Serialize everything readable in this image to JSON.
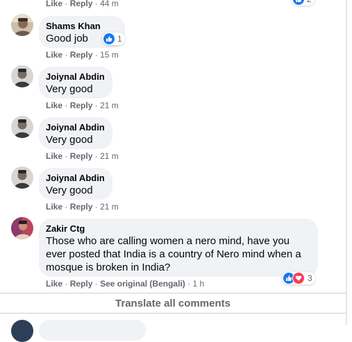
{
  "prev_actions": {
    "like": "Like",
    "reply": "Reply",
    "time": "44 m",
    "reaction_count": "2"
  },
  "comments": [
    {
      "author": "Shams Khan",
      "text": "Good job",
      "like": "Like",
      "reply": "Reply",
      "time": "15 m",
      "reaction_count": "1"
    },
    {
      "author": "Joiynal Abdin",
      "text": "Very good",
      "like": "Like",
      "reply": "Reply",
      "time": "21 m"
    },
    {
      "author": "Joiynal Abdin",
      "text": "Very good",
      "like": "Like",
      "reply": "Reply",
      "time": "21 m"
    },
    {
      "author": "Joiynal Abdin",
      "text": "Very good",
      "like": "Like",
      "reply": "Reply",
      "time": "21 m"
    },
    {
      "author": "Zakir Ctg",
      "text": "Those who are calling women a nero mind, have you ever posted that India is a country of Nero mind when a mosque is broken in India?",
      "like": "Like",
      "reply": "Reply",
      "see_original": "See original (Bengali)",
      "time": "1 h",
      "reaction_count": "3"
    }
  ],
  "translate_all": "Translate all comments",
  "separator": "·",
  "colors": {
    "like_blue": "#1877f2",
    "love_red": "#f33e58",
    "bubble_bg": "#f0f2f5",
    "meta_gray": "#65676b"
  },
  "icons": {
    "like": "thumbs-up-icon",
    "love": "heart-icon"
  }
}
